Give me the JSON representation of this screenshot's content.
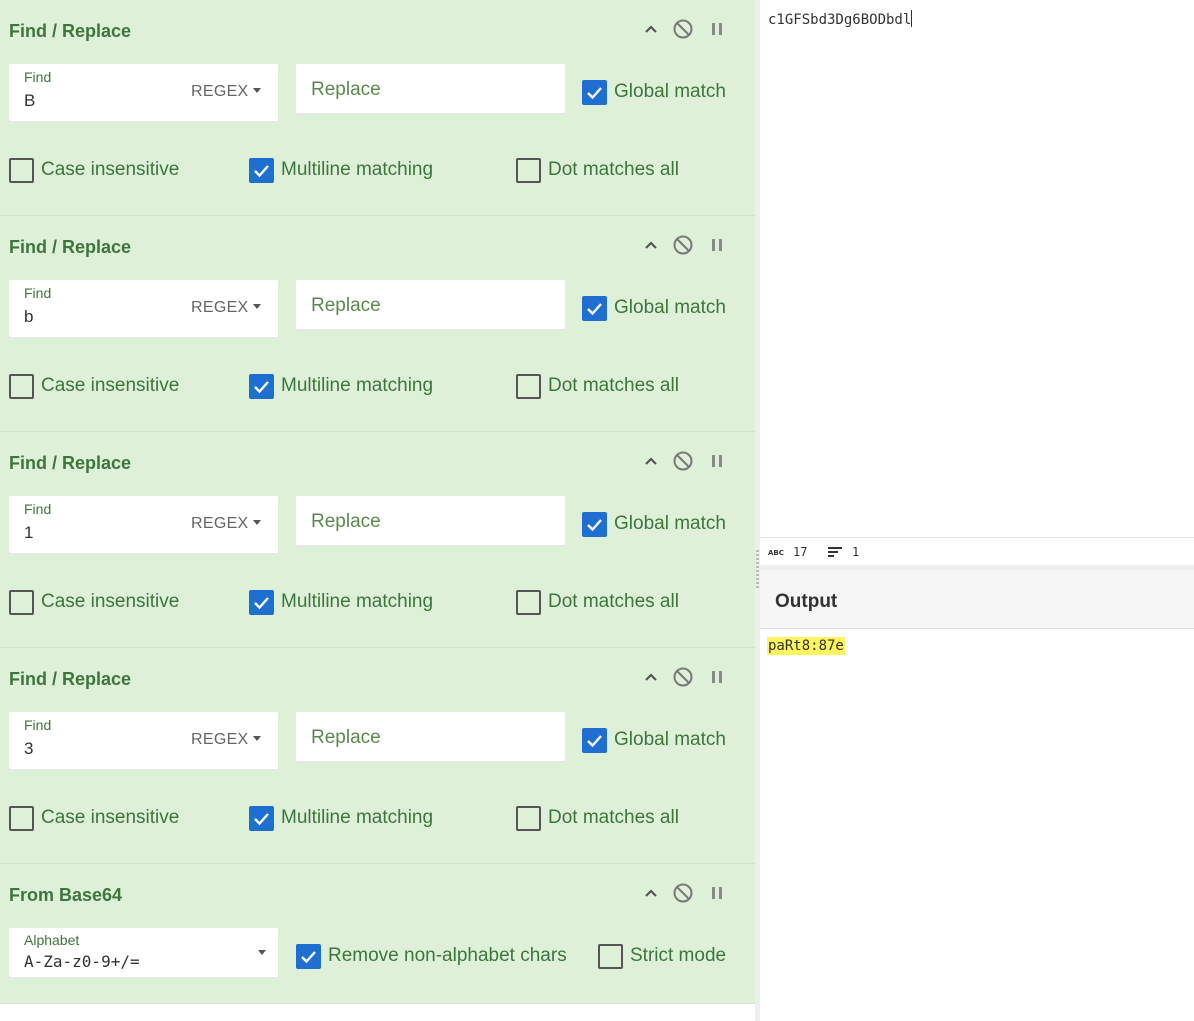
{
  "recipe": {
    "operations": [
      {
        "title": "Find / Replace",
        "find_label": "Find",
        "find_value": "B",
        "find_mode": "REGEX",
        "replace_placeholder": "Replace",
        "global_match": {
          "label": "Global match",
          "checked": true
        },
        "case_insensitive": {
          "label": "Case insensitive",
          "checked": false
        },
        "multiline": {
          "label": "Multiline matching",
          "checked": true
        },
        "dot_all": {
          "label": "Dot matches all",
          "checked": false
        }
      },
      {
        "title": "Find / Replace",
        "find_label": "Find",
        "find_value": "b",
        "find_mode": "REGEX",
        "replace_placeholder": "Replace",
        "global_match": {
          "label": "Global match",
          "checked": true
        },
        "case_insensitive": {
          "label": "Case insensitive",
          "checked": false
        },
        "multiline": {
          "label": "Multiline matching",
          "checked": true
        },
        "dot_all": {
          "label": "Dot matches all",
          "checked": false
        }
      },
      {
        "title": "Find / Replace",
        "find_label": "Find",
        "find_value": "1",
        "find_mode": "REGEX",
        "replace_placeholder": "Replace",
        "global_match": {
          "label": "Global match",
          "checked": true
        },
        "case_insensitive": {
          "label": "Case insensitive",
          "checked": false
        },
        "multiline": {
          "label": "Multiline matching",
          "checked": true
        },
        "dot_all": {
          "label": "Dot matches all",
          "checked": false
        }
      },
      {
        "title": "Find / Replace",
        "find_label": "Find",
        "find_value": "3",
        "find_mode": "REGEX",
        "replace_placeholder": "Replace",
        "global_match": {
          "label": "Global match",
          "checked": true
        },
        "case_insensitive": {
          "label": "Case insensitive",
          "checked": false
        },
        "multiline": {
          "label": "Multiline matching",
          "checked": true
        },
        "dot_all": {
          "label": "Dot matches all",
          "checked": false
        }
      }
    ],
    "from_base64": {
      "title": "From Base64",
      "alphabet_label": "Alphabet",
      "alphabet_value": "A-Za-z0-9+/=",
      "remove_non_alphabet": {
        "label": "Remove non-alphabet chars",
        "checked": true
      },
      "strict_mode": {
        "label": "Strict mode",
        "checked": false
      }
    }
  },
  "input": {
    "text": "c1GFSbd3Dg6BODbdl",
    "length": "17",
    "lines": "1"
  },
  "output": {
    "title": "Output",
    "text": "paRt8:87e"
  },
  "colors": {
    "op_background": "#dff0d8",
    "op_text": "#3c763d",
    "checkbox_checked": "#1f6fd1",
    "output_highlight": "#fff55f"
  }
}
